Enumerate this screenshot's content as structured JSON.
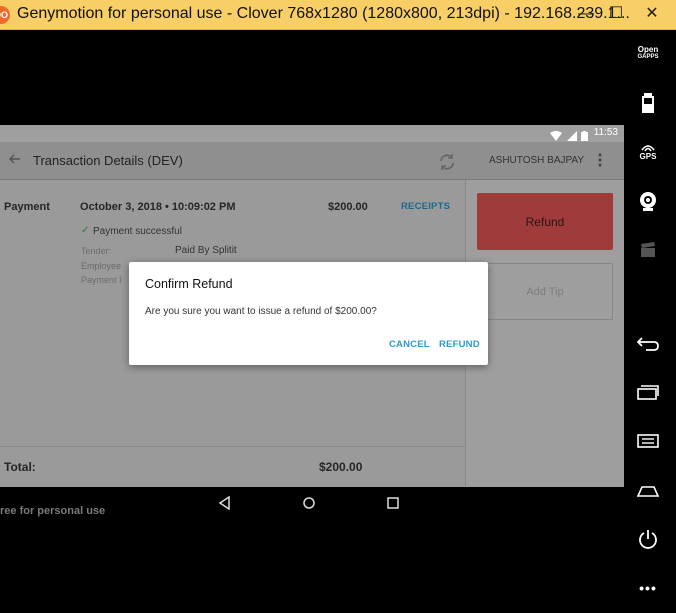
{
  "window": {
    "logo_text": "OO",
    "title": "Genymotion for personal use - Clover 768x1280 (1280x800, 213dpi) - 192.168.239.1...",
    "minimize_glyph": "—",
    "maximize_glyph": "☐",
    "close_glyph": "✕"
  },
  "toolbar": {
    "open_gapps_line1": "Open",
    "open_gapps_line2": "GAPPS",
    "gps_label": "GPS",
    "more_glyph": "•••"
  },
  "status_bar": {
    "time": "11:53"
  },
  "app_bar": {
    "title": "Transaction Details (DEV)",
    "user": "ASHUTOSH BAJPAY"
  },
  "transaction": {
    "type_label": "Payment",
    "datetime": "October 3, 2018 • 10:09:02 PM",
    "amount": "$200.00",
    "receipts_link": "RECEIPTS",
    "status": "Payment successful",
    "tender_label": "Tender:",
    "tender_value": "Paid By Splitit",
    "employee_label": "Employee",
    "payment_id_label": "Payment I",
    "total_label": "Total:",
    "total_value": "$200.00"
  },
  "actions": {
    "refund_label": "Refund",
    "add_tip_label": "Add Tip"
  },
  "dialog": {
    "title": "Confirm Refund",
    "message": "Are you sure you want to issue a refund of $200.00?",
    "cancel_label": "CANCEL",
    "refund_label": "REFUND"
  },
  "watermark": "ree for personal use",
  "colors": {
    "titlebar": "#f8ce66",
    "refund_button": "#a03b3b",
    "dialog_accent": "#2b9bcb"
  }
}
